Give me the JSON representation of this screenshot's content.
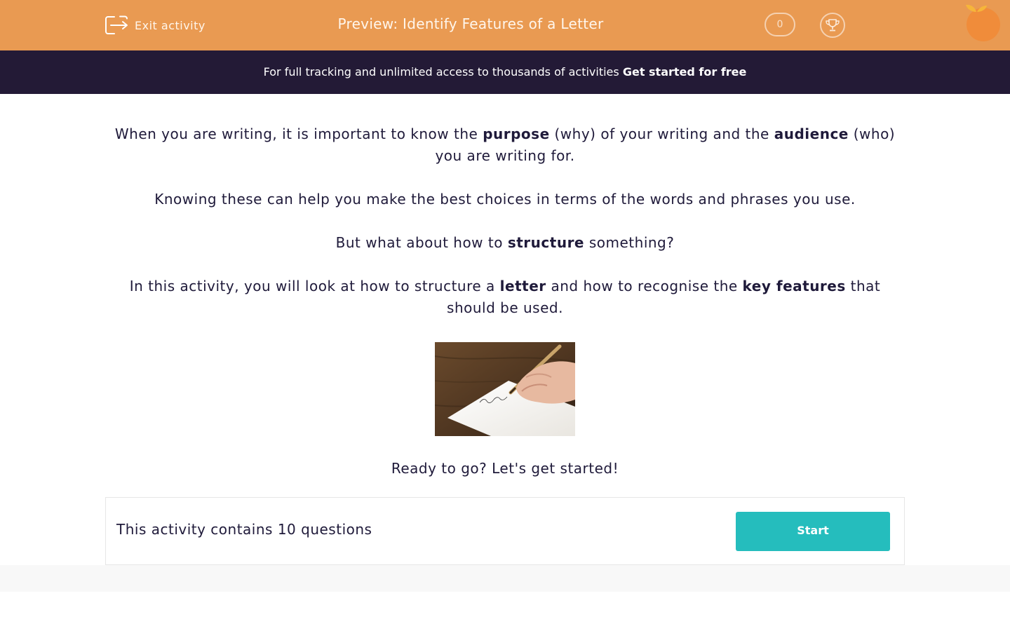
{
  "header": {
    "exit_label": "Exit activity",
    "title": "Preview: Identify Features of a Letter",
    "score": "0"
  },
  "banner": {
    "text": "For full tracking and unlimited access to thousands of activities ",
    "cta": "Get started for free"
  },
  "intro": {
    "p1": {
      "t1": "When you are writing, it is important to know the ",
      "b1": "purpose",
      "t2": " (why) of your writing and the ",
      "b2": "audience",
      "t3": " (who) you are writing for."
    },
    "p2": "Knowing these can help you make the best choices in terms of the words and phrases you use.",
    "p3": {
      "t1": "But what about how to ",
      "b1": "structure",
      "t2": " something?"
    },
    "p4": {
      "t1": "In this activity, you will look at how to structure a ",
      "b1": "letter",
      "t2": " and how to recognise the ",
      "b2": "key features",
      "t3": " that should be used."
    },
    "ready": "Ready to go? Let's get started!"
  },
  "panel": {
    "text": "This activity contains 10 questions",
    "start_label": "Start"
  },
  "colors": {
    "header_bg": "#e99a52",
    "banner_bg": "#231a36",
    "accent": "#25bdbd",
    "text": "#1f1a3a"
  },
  "icons": [
    "exit-icon",
    "trophy-icon",
    "logo-icon"
  ]
}
